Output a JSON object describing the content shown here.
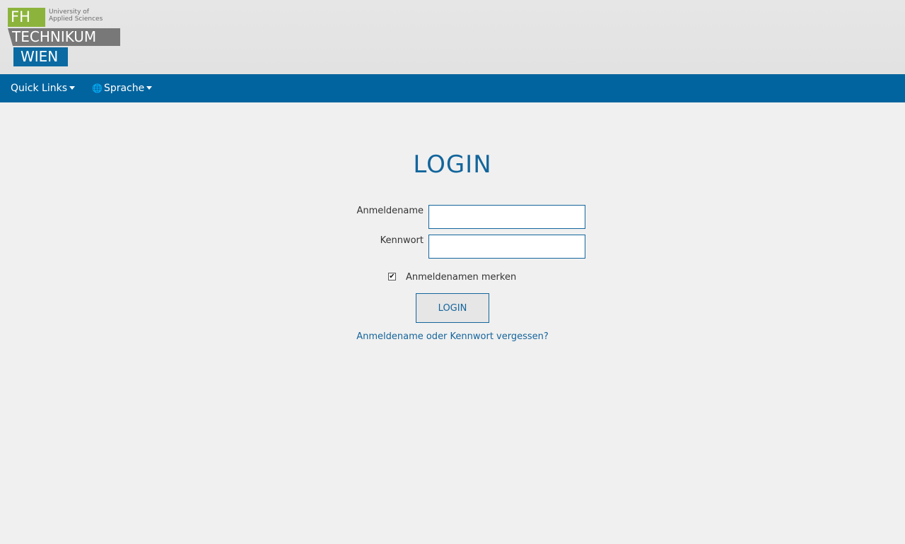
{
  "header": {
    "logo": {
      "fh": "FH",
      "university_line1": "University of",
      "university_line2": "Applied Sciences",
      "technikum": "TECHNIKUM",
      "wien": "WIEN"
    }
  },
  "navbar": {
    "quick_links": "Quick Links",
    "language": "Sprache",
    "language_icon": "translate-icon"
  },
  "login": {
    "title": "LOGIN",
    "username_label": "Anmeldename",
    "username_value": "",
    "password_label": "Kennwort",
    "password_value": "",
    "remember_label": "Anmeldenamen merken",
    "remember_checked": true,
    "submit_label": "LOGIN",
    "forgot_link": "Anmeldename oder Kennwort vergessen?"
  },
  "colors": {
    "brand_blue": "#02649e",
    "brand_green": "#8cb43c",
    "brand_gray": "#787878",
    "title_blue": "#12659c"
  }
}
